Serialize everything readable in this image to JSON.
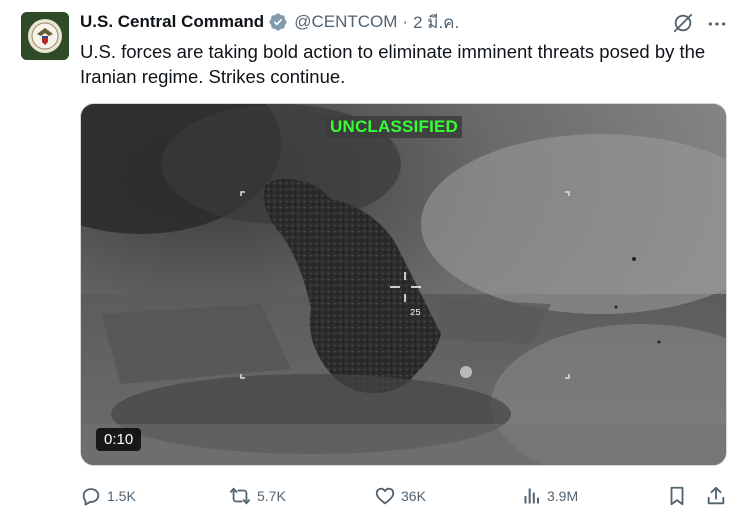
{
  "author": {
    "name": "U.S. Central Command",
    "handle": "@CENTCOM",
    "separator": "·",
    "date": "2 มี.ค."
  },
  "tweet": {
    "text": "U.S. forces are taking bold action to eliminate imminent threats posed by the Iranian regime. Strikes continue."
  },
  "media": {
    "overlay_label": "UNCLASSIFIED",
    "reticle_number": "25",
    "duration": "0:10"
  },
  "actions": {
    "replies": "1.5K",
    "reposts": "5.7K",
    "likes": "36K",
    "views": "3.9M"
  },
  "icons": [
    "avatar-seal",
    "verified-badge-icon",
    "grok-icon",
    "more-icon",
    "reply-icon",
    "repost-icon",
    "like-icon",
    "views-icon",
    "bookmark-icon",
    "share-icon"
  ],
  "colors": {
    "overlay_label": "#33ff33",
    "verified": "#829aab",
    "secondary_text": "#536471"
  }
}
